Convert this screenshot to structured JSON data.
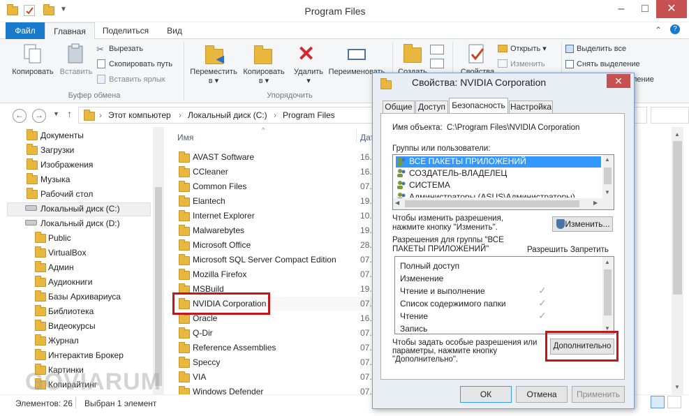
{
  "window": {
    "title": "Program Files"
  },
  "ribbon_tabs": [
    "Файл",
    "Главная",
    "Поделиться",
    "Вид"
  ],
  "ribbon": {
    "copy": "Копировать",
    "paste": "Вставить",
    "cut": "Вырезать",
    "copy_path": "Скопировать путь",
    "paste_shortcut": "Вставить ярлык",
    "clipboard_group": "Буфер обмена",
    "move_to": "Переместить",
    "copy_to": "Копировать",
    "into": "в",
    "delete": "Удалить",
    "rename": "Переименовать",
    "organize_group": "Упорядочить",
    "create": "Создать",
    "properties": "Свойства",
    "open": "Открыть",
    "edit": "Изменить",
    "select_all": "Выделить все",
    "deselect": "Снять выделение",
    "invert": "ление"
  },
  "breadcrumb": [
    "Этот компьютер",
    "Локальный диск (C:)",
    "Program Files"
  ],
  "nav_pane": [
    "Документы",
    "Загрузки",
    "Изображения",
    "Музыка",
    "Рабочий стол",
    "Локальный диск (C:)",
    "Локальный диск (D:)",
    "Public",
    "VirtualBox",
    "Админ",
    "Аудиокниги",
    "Базы Архивариуса",
    "Библиотека",
    "Видеокурсы",
    "Журнал",
    "Интерактив Брокер",
    "Картинки",
    "Копирайтинг"
  ],
  "columns": {
    "name": "Имя",
    "date": "Дата"
  },
  "files": [
    {
      "name": "AVAST Software",
      "date": "16."
    },
    {
      "name": "CCleaner",
      "date": "16."
    },
    {
      "name": "Common Files",
      "date": "07."
    },
    {
      "name": "Elantech",
      "date": "19."
    },
    {
      "name": "Internet Explorer",
      "date": "10."
    },
    {
      "name": "Malwarebytes",
      "date": "19."
    },
    {
      "name": "Microsoft Office",
      "date": "28."
    },
    {
      "name": "Microsoft SQL Server Compact Edition",
      "date": "07."
    },
    {
      "name": "Mozilla Firefox",
      "date": "07."
    },
    {
      "name": "MSBuild",
      "date": "19."
    },
    {
      "name": "NVIDIA Corporation",
      "date": "07."
    },
    {
      "name": "Oracle",
      "date": "16."
    },
    {
      "name": "Q-Dir",
      "date": "07."
    },
    {
      "name": "Reference Assemblies",
      "date": "07."
    },
    {
      "name": "Speccy",
      "date": "07."
    },
    {
      "name": "VIA",
      "date": "07."
    },
    {
      "name": "Windows Defender",
      "date": "07."
    }
  ],
  "status": {
    "count": "Элементов: 26",
    "selected": "Выбран 1 элемент"
  },
  "watermark": "GOVIARUM",
  "dialog": {
    "title": "Свойства: NVIDIA Corporation",
    "tabs": [
      "Общие",
      "Доступ",
      "Безопасность",
      "Настройка"
    ],
    "object_label": "Имя объекта:",
    "object_value": "C:\\Program Files\\NVIDIA Corporation",
    "groups_label": "Группы или пользователи:",
    "users": [
      "ВСЕ ПАКЕТЫ ПРИЛОЖЕНИЙ",
      "СОЗДАТЕЛЬ-ВЛАДЕЛЕЦ",
      "СИСТЕМА",
      "Администраторы (ASUS\\Администраторы)"
    ],
    "change_hint_1": "Чтобы изменить разрешения,",
    "change_hint_2": "нажмите кнопку \"Изменить\".",
    "change_button": "Изменить...",
    "perm_for_1": "Разрешения для группы \"ВСЕ",
    "perm_for_2": "ПАКЕТЫ ПРИЛОЖЕНИЙ\"",
    "allow": "Разрешить",
    "deny": "Запретить",
    "permissions": [
      {
        "name": "Полный доступ",
        "allow": ""
      },
      {
        "name": "Изменение",
        "allow": ""
      },
      {
        "name": "Чтение и выполнение",
        "allow": "✓"
      },
      {
        "name": "Список содержимого папки",
        "allow": "✓"
      },
      {
        "name": "Чтение",
        "allow": "✓"
      },
      {
        "name": "Запись",
        "allow": ""
      }
    ],
    "adv_hint_1": "Чтобы задать особые разрешения или",
    "adv_hint_2": "параметры, нажмите кнопку",
    "adv_hint_3": "\"Дополнительно\".",
    "advanced_button": "Дополнительно",
    "ok": "ОК",
    "cancel": "Отмена",
    "apply": "Применить"
  }
}
